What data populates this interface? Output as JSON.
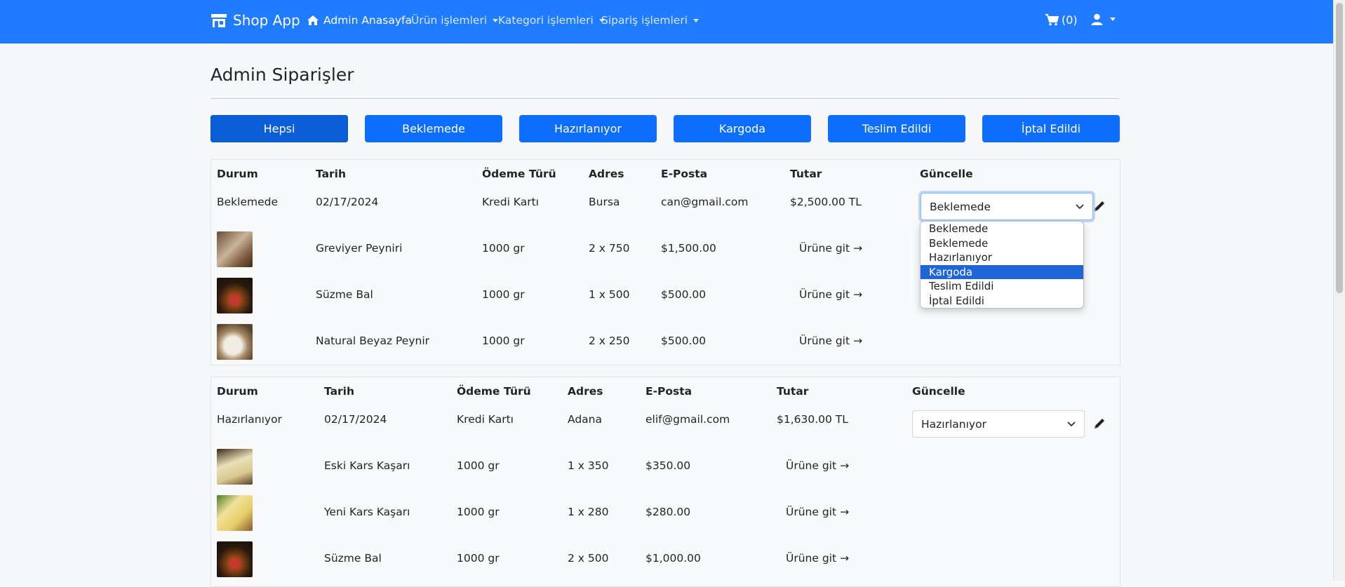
{
  "navbar": {
    "brand": "Shop App",
    "links": [
      {
        "label": "Admin Anasayfa",
        "icon": "home-icon",
        "active": true
      },
      {
        "label": "Ürün işlemleri",
        "dropdown": true
      },
      {
        "label": "Kategori işlemleri",
        "dropdown": true
      },
      {
        "label": "Sipariş işlemleri",
        "dropdown": true
      }
    ],
    "cart_label": "(0)",
    "colors": {
      "bg": "#1f7bff"
    }
  },
  "page": {
    "title": "Admin Siparişler"
  },
  "filters": [
    "Hepsi",
    "Beklemede",
    "Hazırlanıyor",
    "Kargoda",
    "Teslim Edildi",
    "İptal Edildi"
  ],
  "headers": [
    "Durum",
    "Tarih",
    "Ödeme Türü",
    "Adres",
    "E-Posta",
    "Tutar",
    "Güncelle"
  ],
  "orders": [
    {
      "status": "Beklemede",
      "date": "02/17/2024",
      "payment": "Kredi Kartı",
      "address": "Bursa",
      "email": "can@gmail.com",
      "total": "$2,500.00 TL",
      "select_value": "Beklemede",
      "items": [
        {
          "name": "Greviyer Peyniri",
          "weight": "1000 gr",
          "qty": "2 x 750",
          "price": "$1,500.00",
          "link": "Ürüne git"
        },
        {
          "name": "Süzme Bal",
          "weight": "1000 gr",
          "qty": "1 x 500",
          "price": "$500.00",
          "link": "Ürüne git"
        },
        {
          "name": "Natural Beyaz Peynir",
          "weight": "1000 gr",
          "qty": "2 x 250",
          "price": "$500.00",
          "link": "Ürüne git"
        }
      ]
    },
    {
      "status": "Hazırlanıyor",
      "date": "02/17/2024",
      "payment": "Kredi Kartı",
      "address": "Adana",
      "email": "elif@gmail.com",
      "total": "$1,630.00 TL",
      "select_value": "Hazırlanıyor",
      "items": [
        {
          "name": "Eski Kars Kaşarı",
          "weight": "1000 gr",
          "qty": "1 x 350",
          "price": "$350.00",
          "link": "Ürüne git"
        },
        {
          "name": "Yeni Kars Kaşarı",
          "weight": "1000 gr",
          "qty": "1 x 280",
          "price": "$280.00",
          "link": "Ürüne git"
        },
        {
          "name": "Süzme Bal",
          "weight": "1000 gr",
          "qty": "2 x 500",
          "price": "$1,000.00",
          "link": "Ürüne git"
        }
      ]
    }
  ],
  "dropdown_options": [
    "Beklemede",
    "Beklemede",
    "Hazırlanıyor",
    "Kargoda",
    "Teslim Edildi",
    "İptal Edildi"
  ],
  "dropdown_highlighted": "Kargoda"
}
